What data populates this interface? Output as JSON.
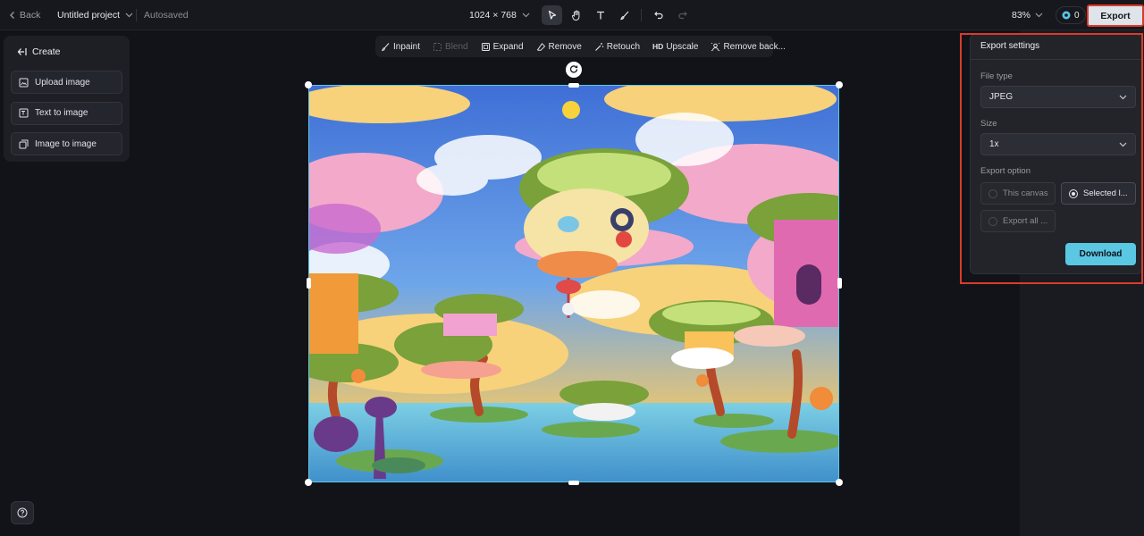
{
  "topbar": {
    "back_label": "Back",
    "project_name": "Untitled project",
    "autosaved": "Autosaved",
    "dimensions": "1024 × 768",
    "zoom": "83%",
    "credits": "0",
    "export_label": "Export"
  },
  "left_panel": {
    "header": "Create",
    "items": [
      {
        "label": "Upload image",
        "icon": "upload-image-icon"
      },
      {
        "label": "Text to image",
        "icon": "text-to-image-icon"
      },
      {
        "label": "Image to image",
        "icon": "image-to-image-icon"
      }
    ]
  },
  "edit_tools": {
    "inpaint": "Inpaint",
    "blend": "Blend",
    "expand": "Expand",
    "remove": "Remove",
    "retouch": "Retouch",
    "hd": "HD",
    "upscale": "Upscale",
    "remove_background": "Remove back..."
  },
  "export_panel": {
    "title": "Export settings",
    "file_type_label": "File type",
    "file_type_value": "JPEG",
    "size_label": "Size",
    "size_value": "1x",
    "export_option_label": "Export option",
    "options": [
      {
        "label": "This canvas",
        "selected": false
      },
      {
        "label": "Selected l...",
        "selected": true
      },
      {
        "label": "Export all ...",
        "selected": false
      }
    ],
    "download_label": "Download"
  },
  "colors": {
    "accent": "#5ac7e3",
    "highlight": "#d93b2b",
    "background": "#121318"
  }
}
